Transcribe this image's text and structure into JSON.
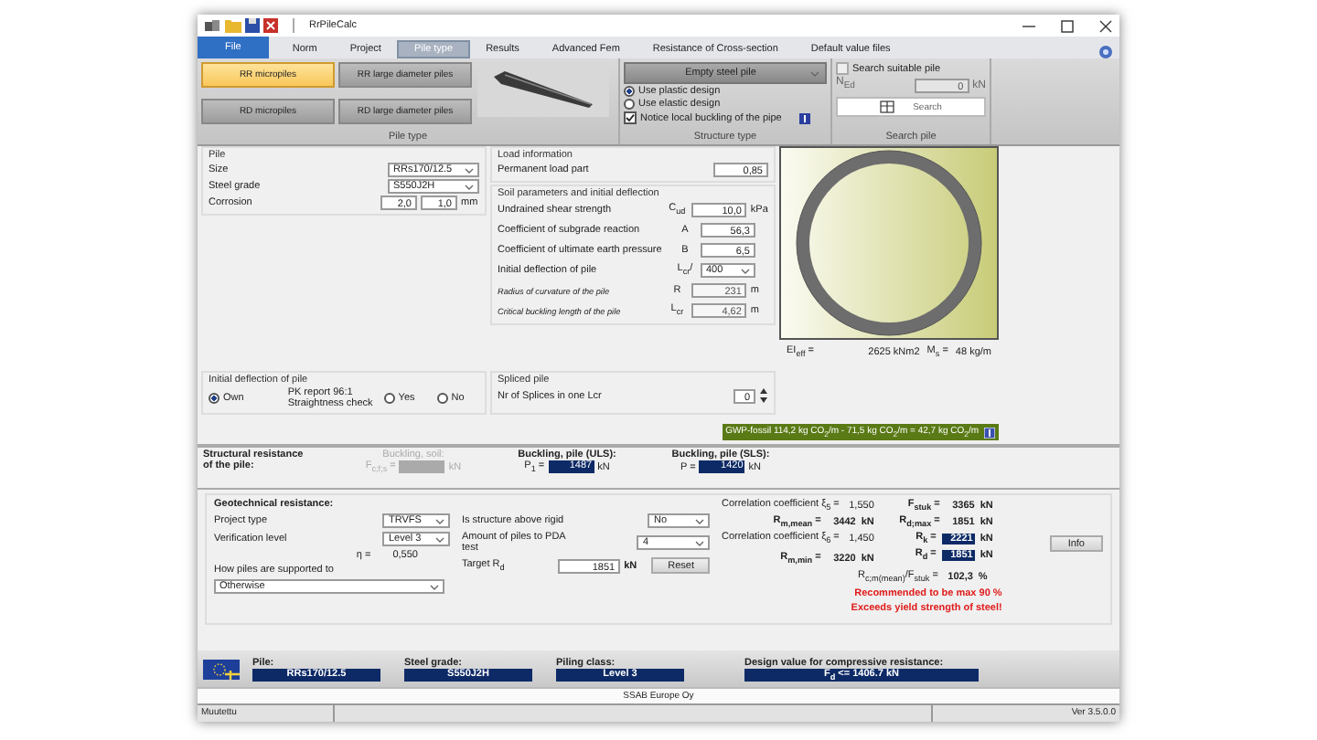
{
  "window": {
    "title": "RrPileCalc"
  },
  "tabs": [
    {
      "label": "File",
      "kind": "file",
      "selected": false
    },
    {
      "label": "Norm",
      "kind": "tab",
      "selected": false
    },
    {
      "label": "Project",
      "kind": "tab",
      "selected": false
    },
    {
      "label": "Pile type",
      "kind": "tab",
      "selected": true
    },
    {
      "label": "Results",
      "kind": "tab",
      "selected": false
    },
    {
      "label": "Advanced Fem",
      "kind": "tab",
      "selected": false
    },
    {
      "label": "Resistance of Cross-section",
      "kind": "tab",
      "selected": false
    },
    {
      "label": "Default value files",
      "kind": "tab",
      "selected": false
    }
  ],
  "ribbon": {
    "pile_type": {
      "label": "Pile type",
      "buttons": [
        {
          "label": "RR micropiles",
          "selected": true
        },
        {
          "label": "RR large diameter piles",
          "selected": false
        },
        {
          "label": "RD micropiles",
          "selected": false
        },
        {
          "label": "RD large diameter piles",
          "selected": false
        }
      ]
    },
    "structure_type": {
      "label": "Structure type",
      "dropdown": "Empty steel pile",
      "options": [
        {
          "label": "Use plastic design",
          "kind": "radio",
          "checked": true
        },
        {
          "label": "Use elastic design",
          "kind": "radio",
          "checked": false
        },
        {
          "label": "Notice local buckling of the pipe",
          "kind": "checkbox",
          "checked": true
        }
      ]
    },
    "search_pile": {
      "label": "Search pile",
      "checkbox": {
        "label": "Search suitable pile",
        "checked": false
      },
      "ned_label": "N$_{Ed}$",
      "ned_value": "0",
      "ned_unit": "kN",
      "button": "Search"
    }
  },
  "pile": {
    "title": "Pile",
    "fields": [
      {
        "label": "Size",
        "kind": "dropdown",
        "value": "RRs170/12.5"
      },
      {
        "label": "Steel grade",
        "kind": "dropdown",
        "value": "S550J2H"
      },
      {
        "label": "Corrosion",
        "kind": "pair",
        "values": [
          "2,0",
          "1,0"
        ],
        "unit": "mm"
      }
    ]
  },
  "load_information": {
    "title": "Load information",
    "label": "Permanent load part",
    "value": "0,85"
  },
  "soil": {
    "title": "Soil parameters and initial deflection",
    "rows": [
      {
        "label": "Undrained shear strength",
        "symbol": "C$_{ud}$",
        "value": "10,0",
        "unit": "kPa",
        "kind": "input"
      },
      {
        "label": "Coefficient of subgrade reaction",
        "symbol": "A",
        "value": "56,3",
        "kind": "input"
      },
      {
        "label": "Coefficient of ultimate earth pressure",
        "symbol": "B",
        "value": "6,5",
        "kind": "input"
      },
      {
        "label": "Initial deflection of pile",
        "symbol": "L$_{cr}$/",
        "value": "400",
        "kind": "dropdown"
      },
      {
        "label": "Radius of curvature of the pile",
        "symbol": "R",
        "value": "231",
        "unit": "m",
        "kind": "readonly"
      },
      {
        "label": "Critical buckling length of the pile",
        "symbol": "L$_{cr}$",
        "value": "4,62",
        "unit": "m",
        "kind": "readonly"
      }
    ]
  },
  "cross_section": {
    "ei_label": "EI$_{eff}$ =",
    "ei_value": "2625 kNm2",
    "mass_label": "M$_{s}$ =",
    "mass_value": "48 kg/m"
  },
  "initial_deflection": {
    "title": "Initial deflection of pile",
    "report_label": [
      "PK report 96:1",
      "Straightness check"
    ],
    "radios": [
      {
        "label": "Own",
        "selected": true
      },
      {
        "label": "Yes",
        "selected": false
      },
      {
        "label": "No",
        "selected": false
      }
    ]
  },
  "spliced_pile": {
    "title": "Spliced pile",
    "label": "Nr of Splices in one Lcr",
    "value": "0"
  },
  "gwp": {
    "text": "GWP-fossil  114,2 kg CO$_{2}$/m - 71,5 kg CO$_{2}$/m = 42,7 kg CO$_{2}$/m"
  },
  "structural_resistance": {
    "title": [
      "Structural resistance",
      "of the pile:"
    ],
    "items": [
      {
        "heading": "Buckling, soil:",
        "symbol": "F$_{c;f;s}$ =",
        "unit": "kN",
        "disabled": true
      },
      {
        "heading": "Buckling, pile (ULS):",
        "symbol": "P$_{1}$ =",
        "value": "1487",
        "unit": "kN",
        "disabled": false
      },
      {
        "heading": "Buckling, pile (SLS):",
        "symbol": "P =",
        "value": "1420",
        "unit": "kN",
        "disabled": false
      }
    ]
  },
  "geotechnical": {
    "title": "Geotechnical resistance:",
    "project_type": {
      "label": "Project type",
      "value": "TRVFS"
    },
    "verification_level": {
      "label": "Verification level",
      "value": "Level 3"
    },
    "eta": {
      "label": "η =",
      "value": "0,550"
    },
    "support": {
      "label": "How piles are supported to",
      "value": "Otherwise"
    },
    "rigid": {
      "label": "Is structure above rigid",
      "value": "No"
    },
    "pda": {
      "label": "Amount of piles to PDA test",
      "value": "4"
    },
    "target": {
      "label": "Target R$_{d}$",
      "value": "1851",
      "unit": "kN",
      "button": "Reset"
    },
    "left_results": [
      {
        "label": "Correlation coefficient ξ$_{5}$ =",
        "value": "1,550",
        "bold": false
      },
      {
        "label": "R$_{m,mean}$ =",
        "value": "3442",
        "unit": "kN",
        "bold": true
      },
      {
        "label": "Correlation coefficient ξ$_{6}$ =",
        "value": "1,450",
        "bold": false
      },
      {
        "label": "R$_{m,min}$ =",
        "value": "3220",
        "unit": "kN",
        "bold": true
      }
    ],
    "right_results": [
      {
        "label": "F$_{stuk}$ =",
        "value": "3365",
        "unit": "kN",
        "highlighted": false
      },
      {
        "label": "R$_{d;max}$ =",
        "value": "1851",
        "unit": "kN",
        "highlighted": false
      },
      {
        "label": "R$_{k}$ =",
        "value": "2221",
        "unit": "kN",
        "highlighted": true
      },
      {
        "label": "R$_{d}$ =",
        "value": "1851",
        "unit": "kN",
        "highlighted": true
      }
    ],
    "ratio": {
      "label": "R$_{c;m(mean)}$/F$_{stuk}$ =",
      "value": "102,3",
      "unit": "%"
    },
    "warnings": [
      "Recommended to be max 90 %",
      "Exceeds yield strength of steel!"
    ],
    "info_button": "Info"
  },
  "summary": [
    {
      "label": "Pile:",
      "value": "RRs170/12.5"
    },
    {
      "label": "Steel grade:",
      "value": "S550J2H"
    },
    {
      "label": "Piling class:",
      "value": "Level 3"
    },
    {
      "label": "Design value for compressive resistance:",
      "value": "F$_{d}$ <= 1406.7 kN"
    }
  ],
  "company": "SSAB Europe Oy",
  "status_bar": {
    "left": "Muutettu",
    "right": "Ver 3.5.0.0"
  }
}
